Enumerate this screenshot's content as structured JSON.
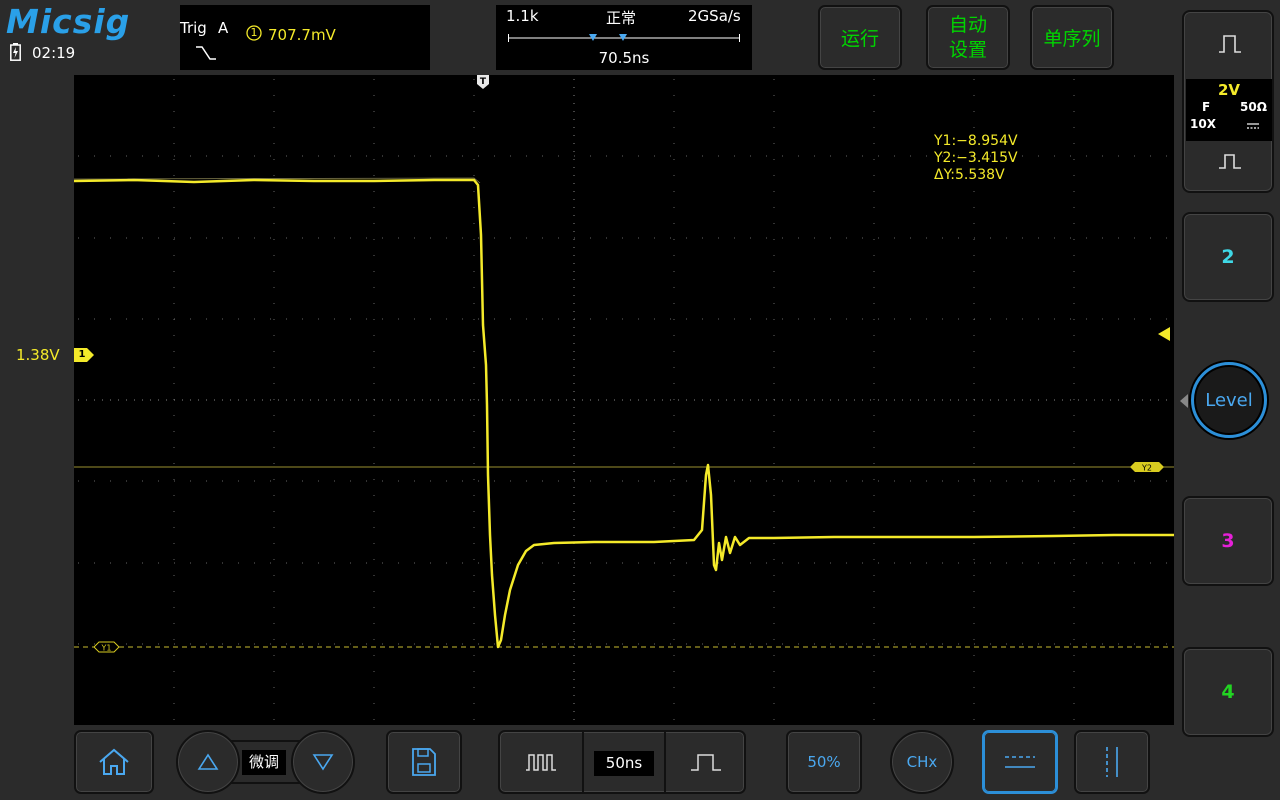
{
  "brand": {
    "logo": "Micsig",
    "clock": "02:19"
  },
  "trigger": {
    "label": "Trig",
    "source": "A",
    "channel_badge": "1",
    "level": "707.7mV",
    "edge": "falling-edge-icon"
  },
  "timebase": {
    "memory_depth": "1.1k",
    "acq_mode": "正常",
    "sample_rate": "2GSa/s",
    "h_position": "70.5ns",
    "timebase_value": "50ns"
  },
  "top_buttons": {
    "run": "运行",
    "auto_line1": "自动",
    "auto_line2": "设置",
    "single": "单序列"
  },
  "channels": {
    "ch1": {
      "scale": "2V",
      "coupling": "F",
      "impedance": "50Ω",
      "probe": "10X",
      "offset_label": "1.38V",
      "marker": "1",
      "color": "#f4ea2a"
    },
    "ch2": {
      "label": "2",
      "color": "#3fd8e6"
    },
    "ch3": {
      "label": "3",
      "color": "#e520d8"
    },
    "ch4": {
      "label": "4",
      "color": "#22d522"
    }
  },
  "cursors": {
    "y1": "Y1:−8.954V",
    "y2": "Y2:−3.415V",
    "dy": "ΔY:5.538V",
    "y1_tag": "Y1",
    "y2_tag": "Y2"
  },
  "trigger_pos_marker": "T",
  "level_knob": "Level",
  "bottom": {
    "fine_label": "微调",
    "pct50": "50%",
    "chx": "CHx"
  },
  "colors": {
    "accent": "#2aa0e8",
    "ch1": "#f4ea2a",
    "button_green": "#00d500",
    "button_blue": "#4aa8f0"
  }
}
